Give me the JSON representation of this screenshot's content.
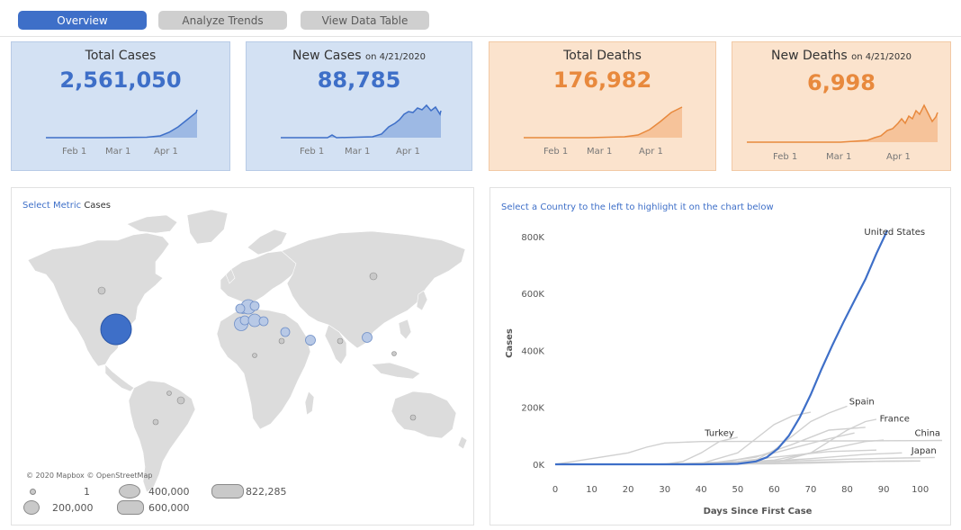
{
  "tabs": [
    {
      "label": "Overview",
      "active": true
    },
    {
      "label": "Analyze Trends",
      "active": false
    },
    {
      "label": "View Data Table",
      "active": false
    }
  ],
  "kpis": {
    "total_cases": {
      "title": "Total Cases",
      "value": "2,561,050",
      "color": "#3e6fc8",
      "ticks": [
        "Feb 1",
        "Mar 1",
        "Apr 1"
      ]
    },
    "new_cases": {
      "title": "New Cases",
      "suffix": "on 4/21/2020",
      "value": "88,785",
      "color": "#3e6fc8",
      "ticks": [
        "Feb 1",
        "Mar 1",
        "Apr 1"
      ]
    },
    "total_deaths": {
      "title": "Total Deaths",
      "value": "176,982",
      "color": "#e8893d",
      "ticks": [
        "Feb 1",
        "Mar 1",
        "Apr 1"
      ]
    },
    "new_deaths": {
      "title": "New Deaths",
      "suffix": "on 4/21/2020",
      "value": "6,998",
      "color": "#e8893d",
      "ticks": [
        "Feb 1",
        "Mar 1",
        "Apr 1"
      ]
    }
  },
  "map_panel": {
    "select_metric_label": "Select Metric",
    "metric_value": "Cases",
    "attribution": "© 2020 Mapbox © OpenStreetMap",
    "legend": [
      {
        "label": "1"
      },
      {
        "label": "400,000"
      },
      {
        "label": "822,285"
      },
      {
        "label": "200,000"
      },
      {
        "label": "600,000"
      }
    ]
  },
  "chart_panel": {
    "instruction": "Select a Country to the left to highlight it on the chart below"
  },
  "chart_data": {
    "type": "line",
    "title": "",
    "xlabel": "Days Since First Case",
    "ylabel": "Cases",
    "xlim": [
      0,
      106
    ],
    "ylim": [
      0,
      850000
    ],
    "x_ticks": [
      0,
      10,
      20,
      30,
      40,
      50,
      60,
      70,
      80,
      90,
      100
    ],
    "y_ticks": [
      {
        "v": 0,
        "label": "0K"
      },
      {
        "v": 200000,
        "label": "200K"
      },
      {
        "v": 400000,
        "label": "400K"
      },
      {
        "v": 600000,
        "label": "600K"
      },
      {
        "v": 800000,
        "label": "800K"
      }
    ],
    "highlight_color": "#3e6fc8",
    "background_color": "#d0d0d0",
    "series": [
      {
        "name": "United States",
        "highlight": true,
        "x": [
          0,
          20,
          40,
          50,
          55,
          58,
          61,
          64,
          67,
          70,
          73,
          76,
          79,
          82,
          85,
          88,
          91
        ],
        "y": [
          0,
          0,
          100,
          1500,
          10000,
          25000,
          55000,
          100000,
          165000,
          245000,
          335000,
          420000,
          500000,
          575000,
          650000,
          740000,
          822285
        ]
      },
      {
        "name": "Spain",
        "x": [
          30,
          45,
          50,
          55,
          60,
          65,
          70,
          75,
          80
        ],
        "y": [
          0,
          200,
          5000,
          15000,
          50000,
          100000,
          150000,
          180000,
          204000
        ]
      },
      {
        "name": "France",
        "x": [
          30,
          50,
          60,
          70,
          75,
          80,
          85,
          88
        ],
        "y": [
          0,
          1000,
          5000,
          40000,
          80000,
          120000,
          150000,
          158000
        ]
      },
      {
        "name": "China",
        "x": [
          0,
          20,
          25,
          30,
          40,
          60,
          80,
          100,
          106
        ],
        "y": [
          0,
          40000,
          60000,
          75000,
          80000,
          81000,
          82000,
          83000,
          83800
        ]
      },
      {
        "name": "Japan",
        "x": [
          20,
          40,
          60,
          70,
          80,
          90,
          100
        ],
        "y": [
          0,
          500,
          2000,
          4000,
          8000,
          11000,
          11500
        ]
      },
      {
        "name": "Turkey",
        "x": [
          30,
          35,
          40,
          45,
          50
        ],
        "y": [
          0,
          10000,
          40000,
          80000,
          95000
        ]
      },
      {
        "name": "",
        "x": [
          30,
          40,
          50,
          55,
          60,
          65,
          70
        ],
        "y": [
          0,
          3000,
          40000,
          90000,
          140000,
          170000,
          183000
        ]
      },
      {
        "name": "",
        "x": [
          40,
          55,
          65,
          75,
          85
        ],
        "y": [
          0,
          25000,
          70000,
          120000,
          130000
        ]
      },
      {
        "name": "",
        "x": [
          25,
          45,
          60,
          75,
          82
        ],
        "y": [
          0,
          5000,
          40000,
          90000,
          110000
        ]
      },
      {
        "name": "",
        "x": [
          40,
          60,
          70,
          85,
          90
        ],
        "y": [
          0,
          15000,
          40000,
          80000,
          85000
        ]
      },
      {
        "name": "",
        "x": [
          30,
          50,
          60,
          75,
          88
        ],
        "y": [
          0,
          10000,
          25000,
          45000,
          50000
        ]
      },
      {
        "name": "",
        "x": [
          35,
          55,
          70,
          85,
          95
        ],
        "y": [
          0,
          8000,
          20000,
          35000,
          40000
        ]
      },
      {
        "name": "",
        "x": [
          30,
          50,
          65,
          80,
          95,
          104
        ],
        "y": [
          0,
          5000,
          12000,
          18000,
          22000,
          24000
        ]
      },
      {
        "name": "",
        "x": [
          20,
          45,
          70,
          100
        ],
        "y": [
          0,
          2000,
          8000,
          12000
        ]
      }
    ],
    "labels": [
      {
        "text": "United States",
        "x": 93,
        "y": 805000
      },
      {
        "text": "Spain",
        "x": 84,
        "y": 210000
      },
      {
        "text": "France",
        "x": 93,
        "y": 150000
      },
      {
        "text": "China",
        "x": 102,
        "y": 100000
      },
      {
        "text": "Japan",
        "x": 101,
        "y": 38000
      },
      {
        "text": "Turkey",
        "x": 45,
        "y": 100000
      }
    ]
  }
}
